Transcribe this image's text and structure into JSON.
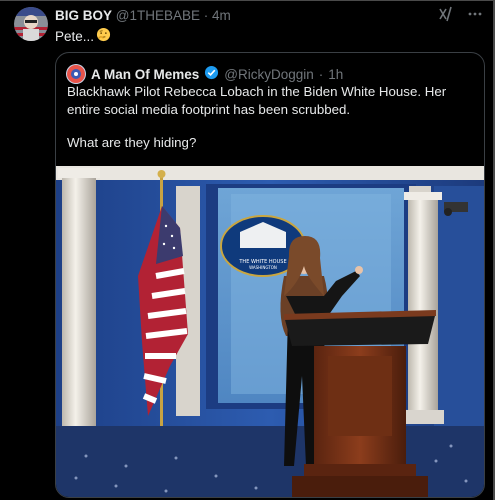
{
  "tweet": {
    "author_name": "BIG BOY",
    "author_handle": "@1THEBABE",
    "separator": "·",
    "time": "4m",
    "text": "Pete...",
    "emoji": "thinking-face",
    "grok_label": "x/"
  },
  "quote": {
    "author_name": "A Man Of Memes",
    "verified": true,
    "author_handle": "@RickyDoggin",
    "separator": "·",
    "time": "1h",
    "text_line1": "Blackhawk Pilot Rebecca Lobach in the Biden White House. Her entire social media footprint has been scrubbed.",
    "text_line2": "What are they hiding?",
    "image": {
      "subject": "Woman at White House press briefing podium",
      "seal_text": "THE WHITE HOUSE WASHINGTON"
    }
  },
  "colors": {
    "background": "#000000",
    "text_primary": "#e7e9ea",
    "text_secondary": "#71767b",
    "verified_blue": "#1d9bf0",
    "border": "#3a3f44"
  }
}
